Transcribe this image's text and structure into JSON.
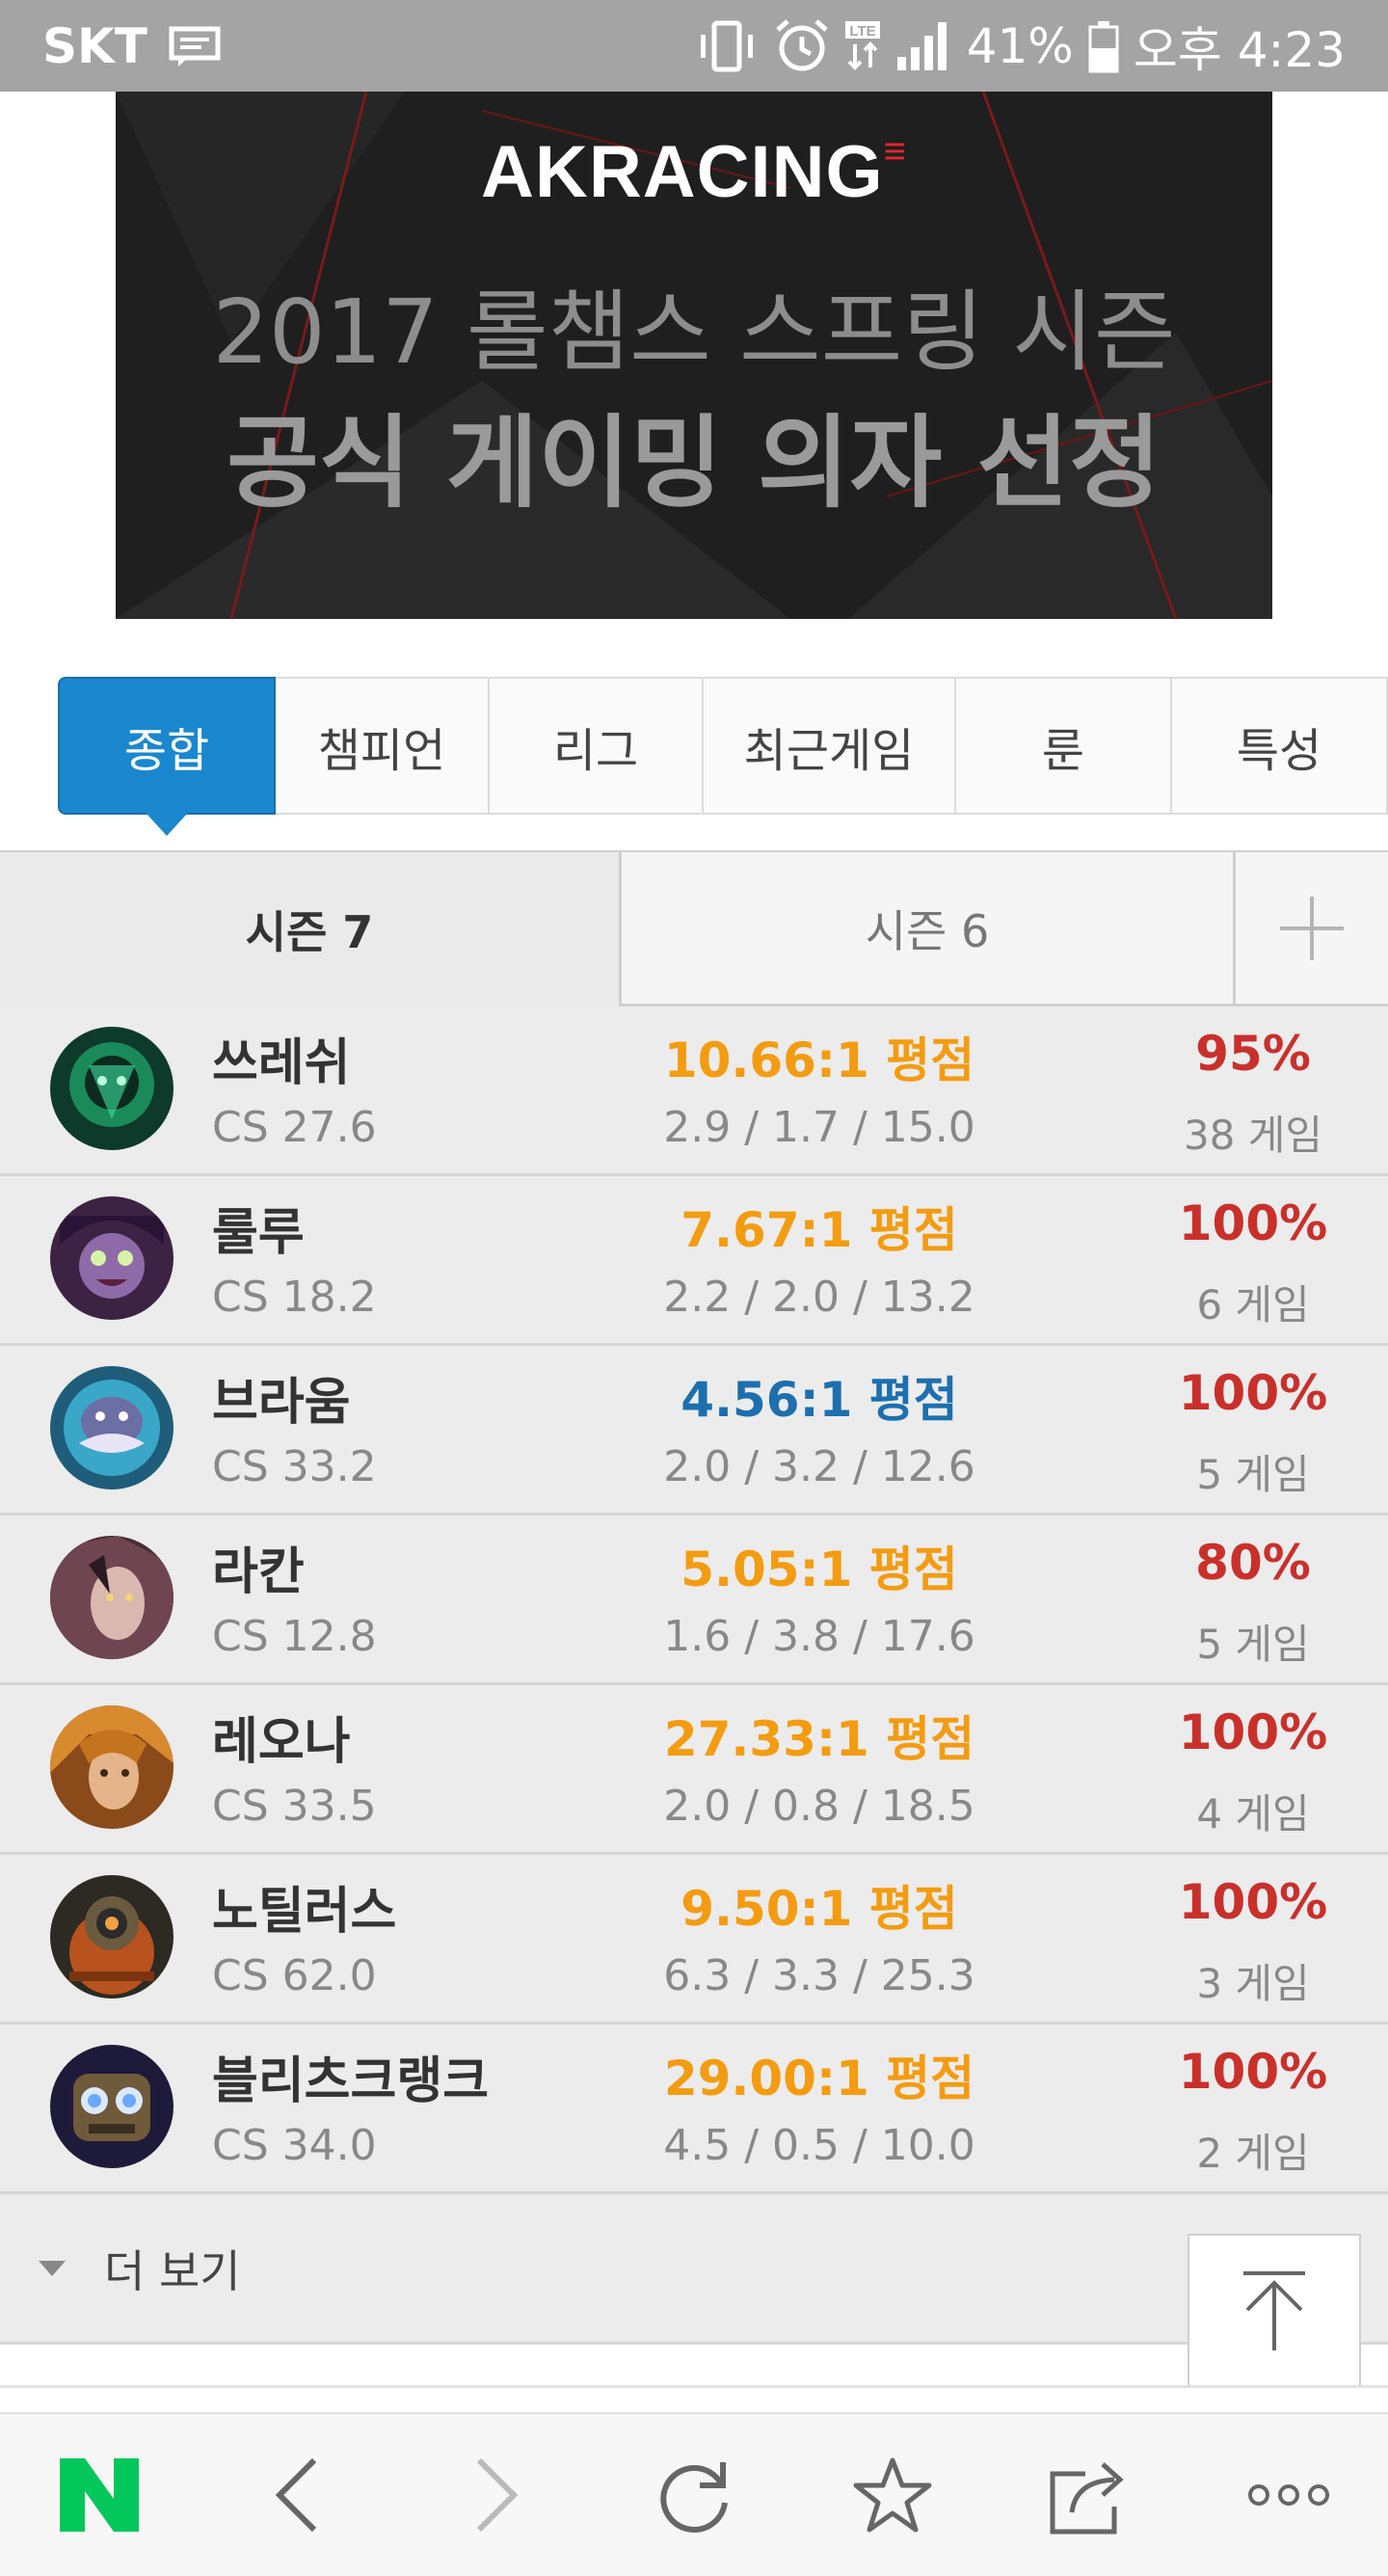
{
  "status_bar": {
    "carrier": "SKT",
    "lte": "LTE",
    "battery_percent": "41%",
    "time": "오후 4:23"
  },
  "banner": {
    "brand": "AKRACING",
    "line1": "2017 롤챔스 스프링 시즌",
    "line2": "공식 게이밍 의자 선정"
  },
  "main_tabs": [
    {
      "label": "종합",
      "active": true
    },
    {
      "label": "챔피언",
      "active": false
    },
    {
      "label": "리그",
      "active": false
    },
    {
      "label": "최근게임",
      "active": false
    },
    {
      "label": "룬",
      "active": false
    },
    {
      "label": "특성",
      "active": false
    }
  ],
  "season_tabs": [
    {
      "label": "시즌 7",
      "active": true
    },
    {
      "label": "시즌 6",
      "active": false
    }
  ],
  "champions": [
    {
      "name": "쓰레쉬",
      "cs": "CS 27.6",
      "kda_ratio": "10.66:1 평점",
      "kda": "2.9 / 1.7 / 15.0",
      "winrate": "95%",
      "games": "38 게임",
      "ratio_color": "orange"
    },
    {
      "name": "룰루",
      "cs": "CS 18.2",
      "kda_ratio": "7.67:1 평점",
      "kda": "2.2 / 2.0 / 13.2",
      "winrate": "100%",
      "games": "6 게임",
      "ratio_color": "orange"
    },
    {
      "name": "브라움",
      "cs": "CS 33.2",
      "kda_ratio": "4.56:1 평점",
      "kda": "2.0 / 3.2 / 12.6",
      "winrate": "100%",
      "games": "5 게임",
      "ratio_color": "blue"
    },
    {
      "name": "라칸",
      "cs": "CS 12.8",
      "kda_ratio": "5.05:1 평점",
      "kda": "1.6 / 3.8 / 17.6",
      "winrate": "80%",
      "games": "5 게임",
      "ratio_color": "orange"
    },
    {
      "name": "레오나",
      "cs": "CS 33.5",
      "kda_ratio": "27.33:1 평점",
      "kda": "2.0 / 0.8 / 18.5",
      "winrate": "100%",
      "games": "4 게임",
      "ratio_color": "orange"
    },
    {
      "name": "노틸러스",
      "cs": "CS 62.0",
      "kda_ratio": "9.50:1 평점",
      "kda": "6.3 / 3.3 / 25.3",
      "winrate": "100%",
      "games": "3 게임",
      "ratio_color": "orange"
    },
    {
      "name": "블리츠크랭크",
      "cs": "CS 34.0",
      "kda_ratio": "29.00:1 평점",
      "kda": "4.5 / 0.5 / 10.0",
      "winrate": "100%",
      "games": "2 게임",
      "ratio_color": "orange"
    }
  ],
  "more": {
    "label": "더 보기"
  },
  "colors": {
    "accent_blue": "#1a87cf",
    "ratio_orange": "#f39c12",
    "ratio_blue": "#1d6fae",
    "winrate_red": "#c9302c",
    "naver_green": "#03c75a"
  },
  "icons": {
    "bottom_nav": [
      "naver-n-icon",
      "back-icon",
      "forward-icon",
      "refresh-icon",
      "bookmark-star-icon",
      "share-icon",
      "more-dots-icon"
    ]
  }
}
